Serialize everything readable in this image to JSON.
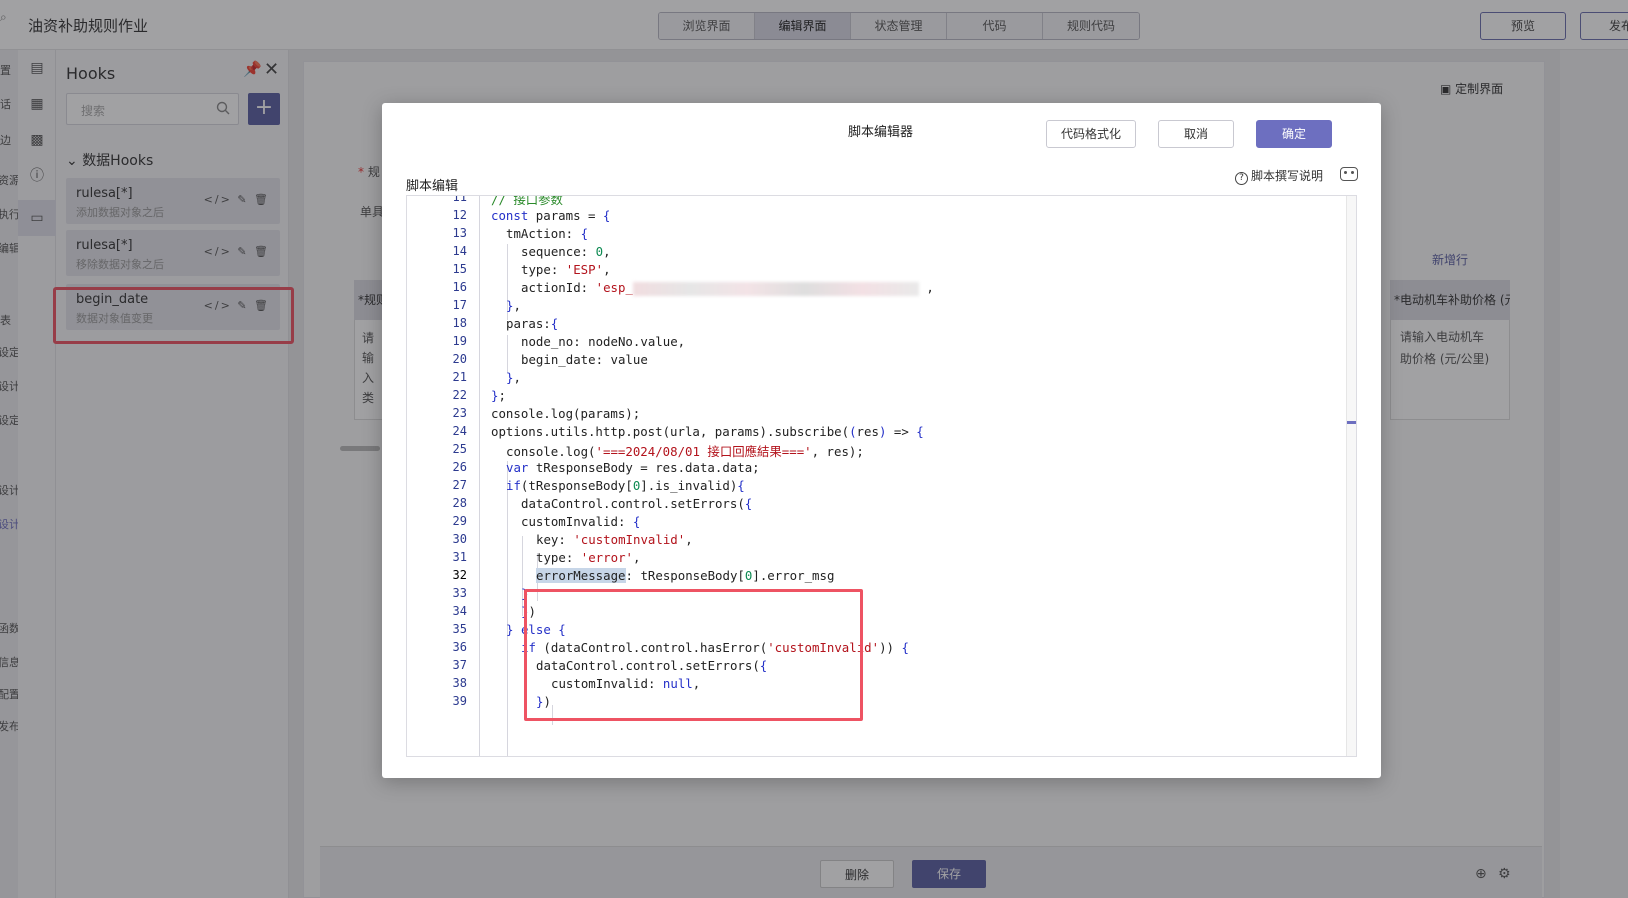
{
  "app": {
    "title": "油资补助规则作业"
  },
  "top_tabs": [
    "浏览界面",
    "编辑界面",
    "状态管理",
    "代码",
    "规则代码"
  ],
  "top_actions": {
    "preview": "预览",
    "publish_partial": "发布"
  },
  "left_rail_labels": [
    "置",
    "话",
    "边",
    "资源",
    "执行",
    "编辑",
    "表",
    "设定",
    "设计",
    "设定",
    "设计",
    "设计",
    "函数",
    "信息",
    "配置",
    "发布"
  ],
  "hooks": {
    "title": "Hooks",
    "search_placeholder": "搜索",
    "group_label": "数据Hooks",
    "items": [
      {
        "name": "rulesa[*]",
        "desc": "添加数据对象之后"
      },
      {
        "name": "rulesa[*]",
        "desc": "移除数据对象之后"
      },
      {
        "name": "begin_date",
        "desc": "数据对象值变更"
      }
    ]
  },
  "background": {
    "customize_label": "定制界面",
    "asterisk_label": "规",
    "single_label": "单具",
    "new_row": "新增行",
    "col_head_left": "*规则",
    "col_head_right": "*电动机车补助价格 (元",
    "cell_left_placeholder": "请输入类",
    "cell_right_placeholder_1": "请输入电动机车",
    "cell_right_placeholder_2": "助价格 (元/公里)",
    "delete_button": "删除",
    "save_button": "保存"
  },
  "modal": {
    "title": "脚本编辑器",
    "format_button": "代码格式化",
    "cancel_button": "取消",
    "confirm_button": "确定",
    "editor_label": "脚本编辑",
    "help_text": "脚本撰写说明",
    "code": {
      "first_line_partial": "// 接口参数",
      "lines": [
        {
          "no": "12",
          "text": "const params = {"
        },
        {
          "no": "13",
          "text": "tmAction: {"
        },
        {
          "no": "14",
          "text": "sequence: 0,"
        },
        {
          "no": "15",
          "text": "type: 'ESP',"
        },
        {
          "no": "16",
          "text": "actionId: 'esp_"
        },
        {
          "no": "17",
          "text": "},"
        },
        {
          "no": "18",
          "text": "paras:{"
        },
        {
          "no": "19",
          "text": "node_no: nodeNo.value,"
        },
        {
          "no": "20",
          "text": "begin_date: value"
        },
        {
          "no": "21",
          "text": "},"
        },
        {
          "no": "22",
          "text": "};"
        },
        {
          "no": "23",
          "text": "console.log(params);"
        },
        {
          "no": "24",
          "text": "options.utils.http.post(urla, params).subscribe((res) => {"
        },
        {
          "no": "25",
          "text": "console.log('===2024/08/01 接口回應結果===', res);"
        },
        {
          "no": "26",
          "text": "var tResponseBody = res.data.data;"
        },
        {
          "no": "27",
          "text": "if(tResponseBody[0].is_invalid){"
        },
        {
          "no": "28",
          "text": "dataControl.control.setErrors({"
        },
        {
          "no": "29",
          "text": "customInvalid: {"
        },
        {
          "no": "30",
          "text": "key: 'customInvalid',"
        },
        {
          "no": "31",
          "text": "type: 'error',"
        },
        {
          "no": "32",
          "text": "errorMessage: tResponseBody[0].error_msg"
        },
        {
          "no": "33",
          "text": "}"
        },
        {
          "no": "34",
          "text": "})"
        },
        {
          "no": "35",
          "text": "} else {"
        },
        {
          "no": "36",
          "text": "if (dataControl.control.hasError('customInvalid')) {"
        },
        {
          "no": "37",
          "text": "dataControl.control.setErrors({"
        },
        {
          "no": "38",
          "text": "customInvalid: null,"
        },
        {
          "no": "39",
          "text": "})"
        }
      ]
    }
  }
}
